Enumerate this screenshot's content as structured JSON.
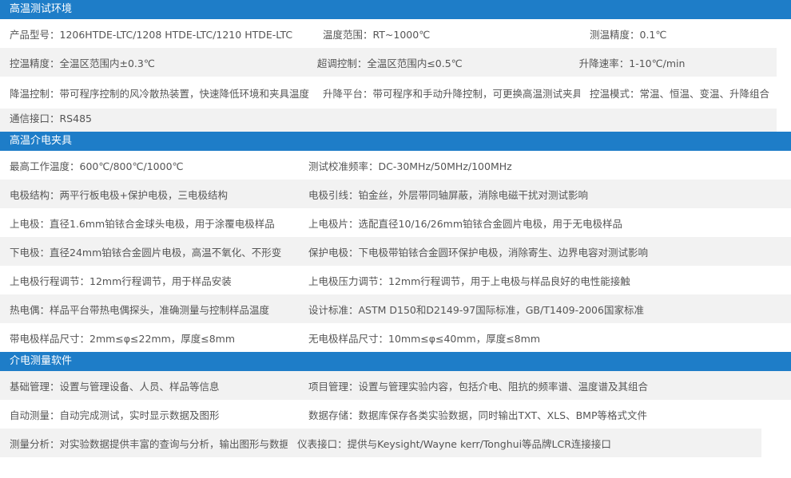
{
  "sections": [
    {
      "title": "高温测试环境",
      "rows": [
        [
          "产品型号：1206HTDE-LTC/1208 HTDE-LTC/1210 HTDE-LTC",
          "温度范围：RT~1000℃",
          "测温精度：0.1℃"
        ],
        [
          "控温精度：全温区范围内±0.3℃",
          "超调控制：全温区范围内≤0.5℃",
          "升降速率：1-10℃/min"
        ],
        [
          "降温控制：带可程序控制的风冷散热装置，快速降低环境和夹具温度",
          "升降平台：带可程序和手动升降控制，可更换高温测试夹具",
          "控温模式：常温、恒温、变温、升降组合"
        ],
        [
          "通信接口：RS485",
          "",
          ""
        ]
      ]
    },
    {
      "title": "高温介电夹具",
      "rows": [
        [
          "最高工作温度：600℃/800℃/1000℃",
          "测试校准频率：DC-30MHz/50MHz/100MHz"
        ],
        [
          "电极结构：两平行板电极+保护电极，三电极结构",
          "电极引线：铂金丝，外层带同轴屏蔽，消除电磁干扰对测试影响"
        ],
        [
          "上电极：直径1.6mm铂铱合金球头电极，用于涂覆电极样品",
          "上电极片：选配直径10/16/26mm铂铱合金圆片电极，用于无电极样品"
        ],
        [
          "下电极：直径24mm铂铱合金圆片电极，高温不氧化、不形变",
          "保护电极：下电极带铂铱合金圆环保护电极，消除寄生、边界电容对测试影响"
        ],
        [
          "上电极行程调节：12mm行程调节，用于样品安装",
          "上电极压力调节：12mm行程调节，用于上电极与样品良好的电性能接触"
        ],
        [
          "热电偶：样品平台带热电偶探头，准确测量与控制样品温度",
          "设计标准：ASTM D150和D2149-97国际标准，GB/T1409-2006国家标准"
        ],
        [
          "带电极样品尺寸：2mm≤φ≤22mm，厚度≤8mm",
          "无电极样品尺寸：10mm≤φ≤40mm，厚度≤8mm"
        ]
      ]
    },
    {
      "title": "介电测量软件",
      "rows": [
        [
          "基础管理：设置与管理设备、人员、样品等信息",
          "项目管理：设置与管理实验内容，包括介电、阻抗的频率谱、温度谱及其组合"
        ],
        [
          "自动测量：自动完成测试，实时显示数据及图形",
          "数据存储：数据库保存各类实验数据，同时输出TXT、XLS、BMP等格式文件"
        ],
        [
          "测量分析：对实验数据提供丰富的查询与分析，输出图形与数据",
          "仪表接口：提供与Keysight/Wayne kerr/Tonghui等品牌LCR连接接口"
        ]
      ]
    }
  ]
}
